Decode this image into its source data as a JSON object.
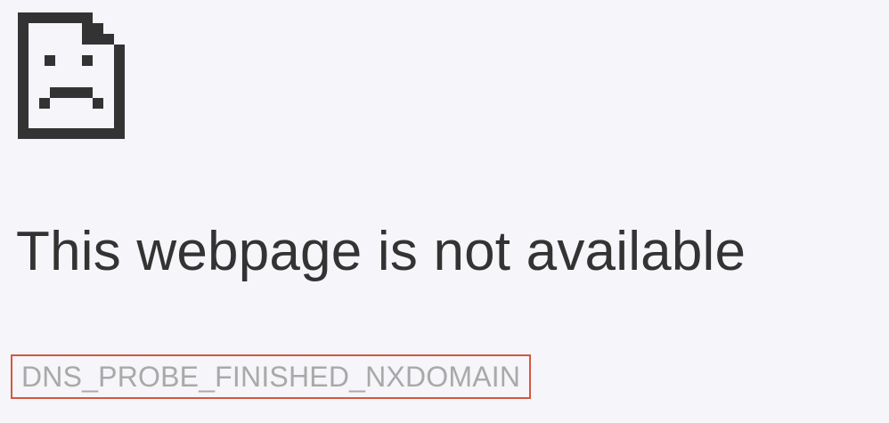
{
  "error_page": {
    "icon": "sad-page-icon",
    "title": "This webpage is not available",
    "error_code": "DNS_PROBE_FINISHED_NXDOMAIN"
  },
  "colors": {
    "background": "#f6f5f9",
    "icon": "#333333",
    "title_text": "#333333",
    "error_code_text": "#a9a9a9",
    "highlight_border": "#d4583f"
  }
}
